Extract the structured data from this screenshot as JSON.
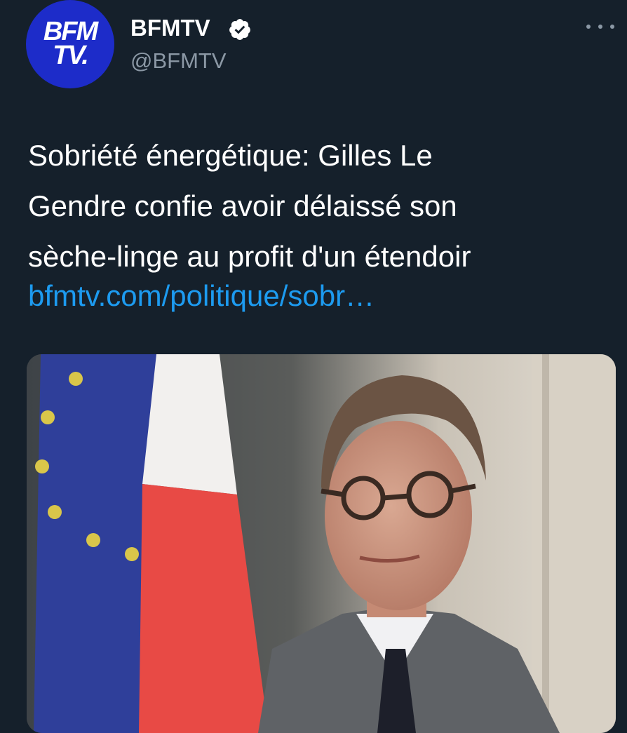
{
  "account": {
    "avatar_line1": "BFM",
    "avatar_line2": "TV.",
    "display_name": "BFMTV",
    "handle": "@BFMTV",
    "verified_icon": "verified-badge-icon",
    "more_icon": "more-horizontal-icon"
  },
  "tweet": {
    "text_lines": [
      "Sobriété énergétique: Gilles Le",
      "Gendre confie avoir délaissé son",
      "sèche-linge au profit d'un étendoir"
    ],
    "link_text": "bfmtv.com/politique/sobr…"
  },
  "colors": {
    "background": "#15202b",
    "link": "#1d9bf0",
    "secondary_text": "#8b98a5",
    "avatar_bg": "#1d2cc9"
  }
}
